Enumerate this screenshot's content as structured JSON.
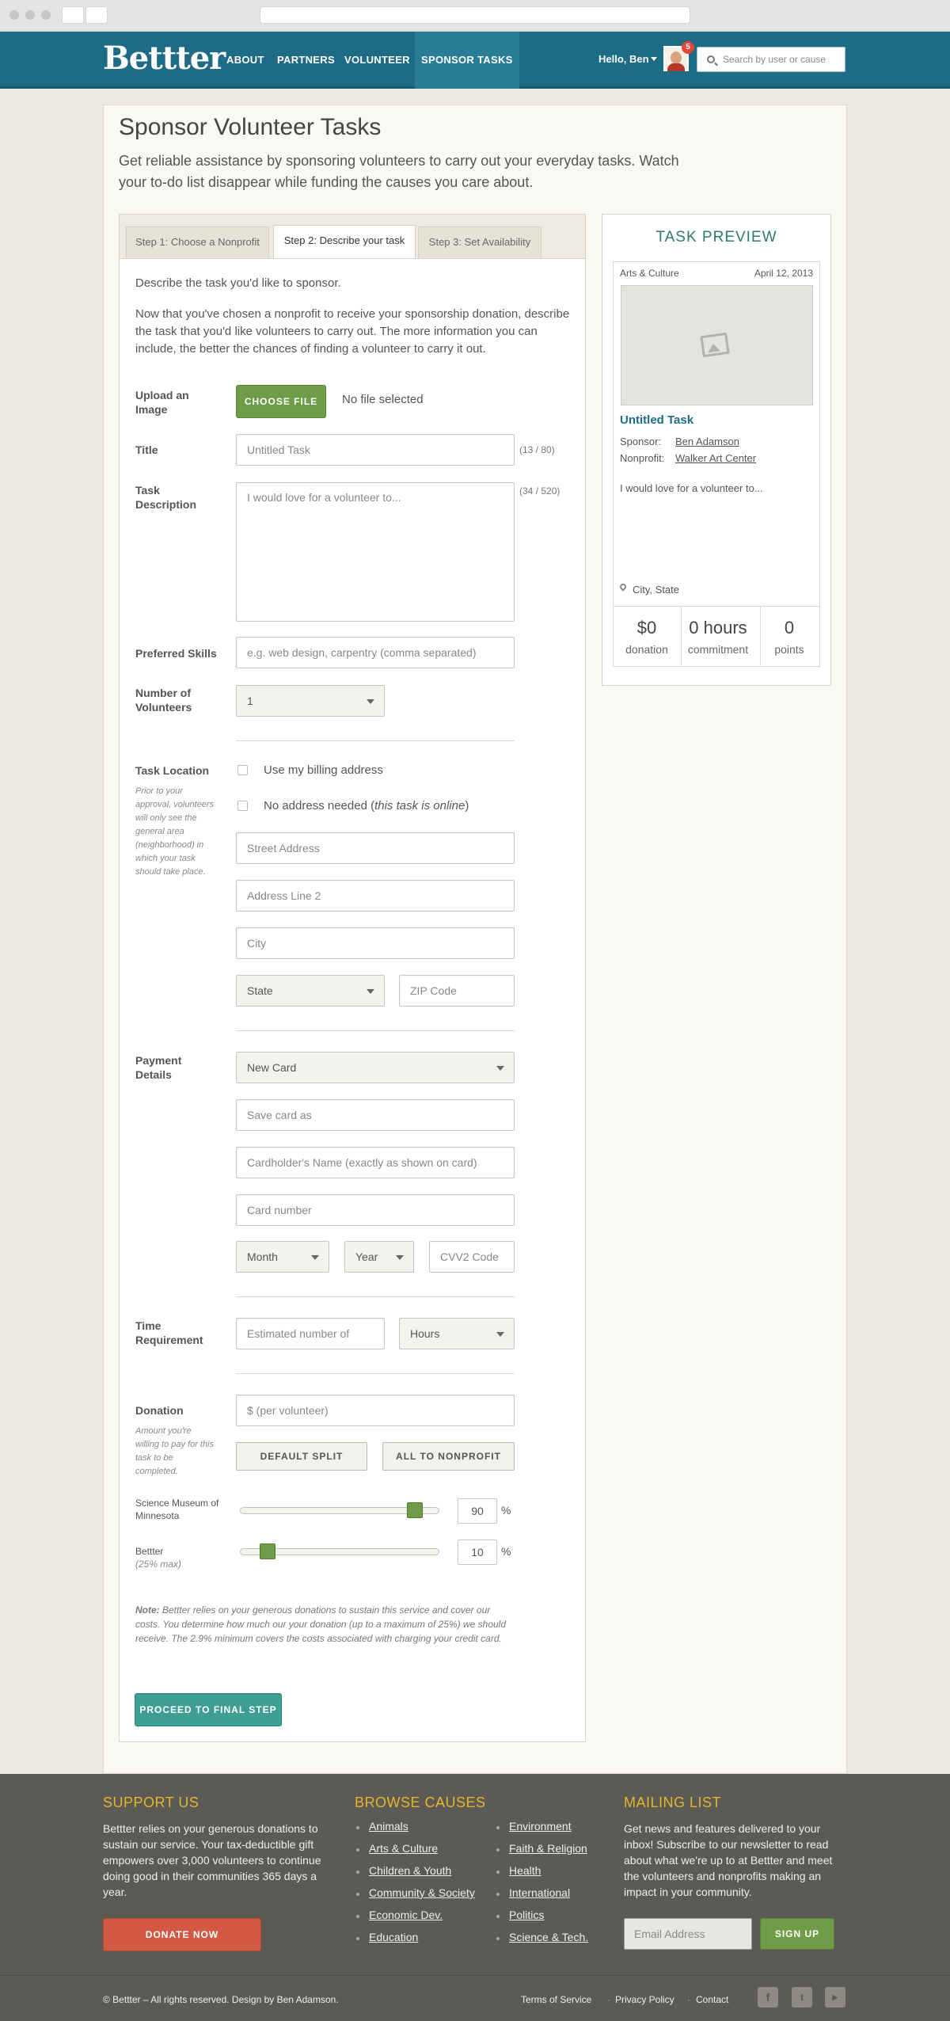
{
  "header": {
    "logo": "Bettter",
    "nav": [
      "ABOUT",
      "PARTNERS",
      "VOLUNTEER",
      "SPONSOR TASKS"
    ],
    "hello": "Hello, Ben",
    "notif_count": "5",
    "search_placeholder": "Search by user or cause"
  },
  "page": {
    "title": "Sponsor Volunteer Tasks",
    "lead": "Get reliable assistance by sponsoring volunteers to carry out your everyday tasks. Watch your to-do list disappear while funding the causes you care about."
  },
  "tabs": [
    "Step 1: Choose a Nonprofit",
    "Step 2: Describe your task",
    "Step 3: Set Availability"
  ],
  "form": {
    "intro1": "Describe the task you'd like to sponsor.",
    "intro2": "Now that you've chosen a nonprofit to receive your sponsorship donation, describe the task that you'd like volunteers to carry out. The more information you can include, the better the chances of finding a volunteer to carry it out.",
    "upload_label": "Upload an Image",
    "choose_file": "CHOOSE FILE",
    "no_file": "No file selected",
    "title_label": "Title",
    "title_placeholder": "Untitled Task",
    "title_count": "(13 / 80)",
    "desc_label": "Task Description",
    "desc_placeholder": "I would love for a volunteer to...",
    "desc_count": "(34 / 520)",
    "skills_label": "Preferred Skills",
    "skills_placeholder": "e.g. web design, carpentry  (comma separated)",
    "volunteers_label": "Number of Volunteers",
    "volunteers_value": "1",
    "location_label": "Task Location",
    "location_hint": "Prior to your approval, volunteers will only see the general area (neighborhood) in which your task should take place.",
    "billing_label": "Use my billing address",
    "no_address_label": "No address needed (",
    "no_address_em": "this task is online",
    "no_address_end": ")",
    "street_placeholder": "Street Address",
    "address2_placeholder": "Address Line 2",
    "city_placeholder": "City",
    "state_value": "State",
    "zip_placeholder": "ZIP Code",
    "payment_label": "Payment Details",
    "card_value": "New Card",
    "save_card_placeholder": "Save card as",
    "cardholder_placeholder": "Cardholder's Name (exactly as shown on card)",
    "card_number_placeholder": "Card number",
    "month_value": "Month",
    "year_value": "Year",
    "cvv_placeholder": "CVV2 Code",
    "time_label": "Time Requirement",
    "time_placeholder": "Estimated number of",
    "hours_value": "Hours",
    "donation_label": "Donation",
    "donation_hint": "Amount you're willing to pay for this task to be completed.",
    "donation_placeholder": "$ (per volunteer)",
    "default_split": "DEFAULT SPLIT",
    "all_nonprofit": "ALL TO NONPROFIT",
    "split1_label": "Science Museum of Minnesota",
    "split1_value": "90",
    "split1_level": 0.9,
    "split2_label": "Bettter",
    "split2_hint": "(25% max)",
    "split2_value": "10",
    "split2_level": 0.1,
    "pct": "%",
    "note_label": "Note:",
    "note_text": " Bettter relies on your generous donations to sustain this service and cover our costs. You determine how much our your donation (up to a maximum of 25%) we should receive. The 2.9% minimum covers the costs associated with charging your credit card.",
    "proceed": "PROCEED TO FINAL STEP"
  },
  "preview": {
    "heading": "TASK PREVIEW",
    "category": "Arts & Culture",
    "date": "April 12, 2013",
    "task_title": "Untitled Task",
    "sponsor_label": "Sponsor:",
    "sponsor": "Ben Adamson",
    "nonprofit_label": "Nonprofit:",
    "nonprofit": "Walker Art Center",
    "description": "I would love for a volunteer to...",
    "location": "City, State",
    "stats": [
      {
        "value": "$0",
        "label": "donation"
      },
      {
        "value": "0 hours",
        "label": "commitment"
      },
      {
        "value": "0",
        "label": "points"
      }
    ]
  },
  "footer": {
    "support_heading": "SUPPORT US",
    "support_text": "Bettter relies on your generous donations to sustain our service. Your tax-deductible gift empowers over 3,000 volunteers to continue doing good in their communities 365 days a year.",
    "donate": "DONATE NOW",
    "causes_heading": "BROWSE CAUSES",
    "causes_col1": [
      "Animals",
      "Arts & Culture",
      "Children & Youth",
      "Community & Society",
      "Economic Dev.",
      "Education"
    ],
    "causes_col2": [
      "Environment",
      "Faith & Religion",
      "Health",
      "International",
      "Politics",
      "Science & Tech."
    ],
    "mailing_heading": "MAILING LIST",
    "mailing_text": "Get news and features delivered to your inbox! Subscribe to our newsletter to read about what we're up to at Bettter and meet the volunteers and nonprofits making an impact in your community.",
    "email_placeholder": "Email Address",
    "signup": "SIGN UP",
    "copyright": "© Bettter – All rights reserved.  Design by Ben Adamson.",
    "links": [
      "Terms of Service",
      "Privacy Policy",
      "Contact"
    ],
    "social": [
      "facebook-icon",
      "twitter-icon",
      "youtube-icon"
    ]
  },
  "colors": {
    "header": "#1e6b85",
    "accent_green": "#6f9c47",
    "teal": "#3f9e94",
    "footer": "#5b5a55",
    "footer_heading": "#e7b62c",
    "donate": "#d25a44"
  }
}
